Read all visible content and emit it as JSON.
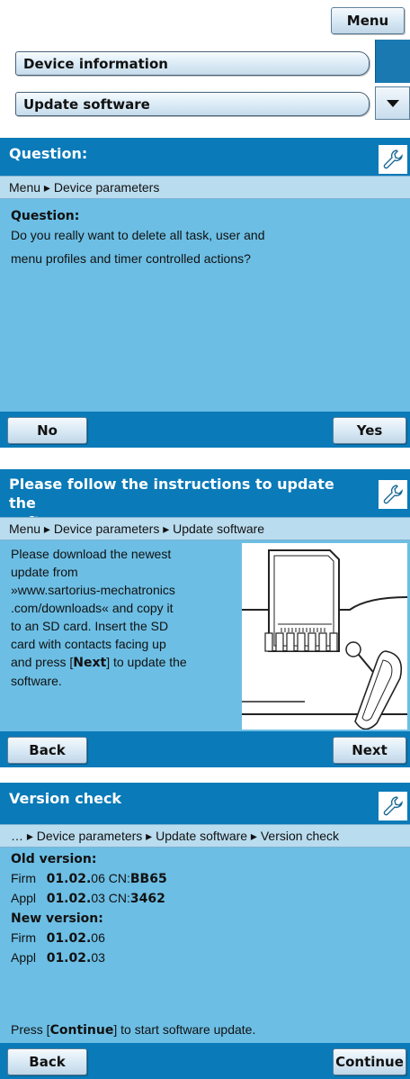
{
  "menu": {
    "title_button": "Menu",
    "items": [
      {
        "label": "Device information"
      },
      {
        "label": "Update software"
      }
    ]
  },
  "panels": [
    {
      "title": "Question:",
      "breadcrumb": "Menu ▸ Device parameters",
      "heading": "Question:",
      "lines": [
        "Do you really want to delete all task, user and",
        "menu profiles and timer controlled actions?"
      ],
      "left_button": "No",
      "right_button": "Yes"
    },
    {
      "title_line1": "Please follow the instructions to update the",
      "title_line2": "software.",
      "breadcrumb": "Menu ▸ Device parameters ▸ Update software",
      "lines": [
        "Please download the newest",
        "update from",
        "»www.sartorius-mechatronics",
        ".com/downloads« and copy it",
        "to an SD card. Insert the SD",
        "card with contacts facing up",
        "and press [",
        "Next",
        "] to update the",
        "software."
      ],
      "left_button": "Back",
      "right_button": "Next"
    },
    {
      "title": "Version check",
      "breadcrumb": "… ▸ Device parameters ▸ Update software ▸ Version check",
      "old_heading": "Old version:",
      "old_firm": {
        "label": "Firm",
        "bold": "01.02.",
        "rest": "06 CN:",
        "code": "BB65"
      },
      "old_appl": {
        "label": "Appl",
        "bold": "01.02.",
        "rest": "03 CN:",
        "code": "3462"
      },
      "new_heading": "New version:",
      "new_firm": {
        "label": "Firm",
        "bold": "01.02.",
        "rest": "06"
      },
      "new_appl": {
        "label": "Appl",
        "bold": "01.02.",
        "rest": "03"
      },
      "press_pre": "Press [",
      "press_bold": "Continue",
      "press_post": "] to start software update.",
      "left_button": "Back",
      "right_button": "Continue"
    }
  ],
  "icons": {
    "wrench": "wrench-icon",
    "scroll_down": "arrow-down-icon",
    "illustration": "sd-card-illustration"
  },
  "colors": {
    "header_blue": "#0a7ab8",
    "panel_bg": "#6cbee4",
    "breadcrumb_bg": "#b9dcef",
    "button_bg": "#d7e8f4"
  }
}
